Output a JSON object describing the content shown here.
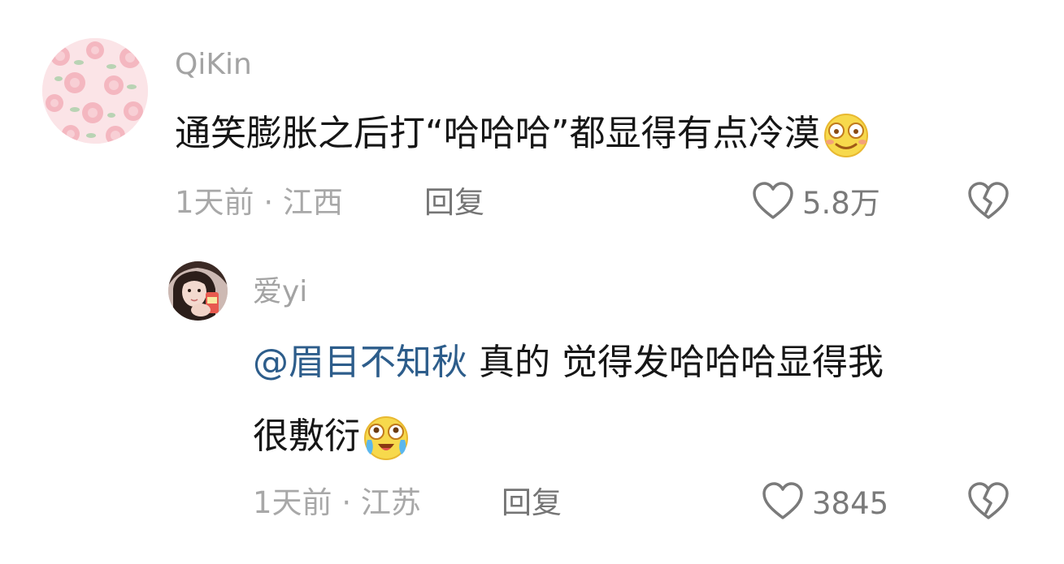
{
  "comments": [
    {
      "username": "QiKin",
      "text": "通笑膨胀之后打“哈哈哈”都显得有点冷漠",
      "emoji_icon": "smile-emoji-icon",
      "time": "1天前",
      "separator": "·",
      "location": "江西",
      "reply_label": "回复",
      "likes": "5.8万"
    },
    {
      "username": "爱yi",
      "mention": "@眉目不知秋",
      "text_line1": " 真的 觉得发哈哈哈显得我",
      "text_line2": "很敷衍",
      "emoji_icon": "tears-of-joy-emoji-icon",
      "time": "1天前",
      "separator": "·",
      "location": "江苏",
      "reply_label": "回复",
      "likes": "3845"
    }
  ],
  "colors": {
    "username": "#a3a3a3",
    "text": "#161616",
    "mention": "#2d5d8b",
    "meta": "#a8a8a8"
  }
}
